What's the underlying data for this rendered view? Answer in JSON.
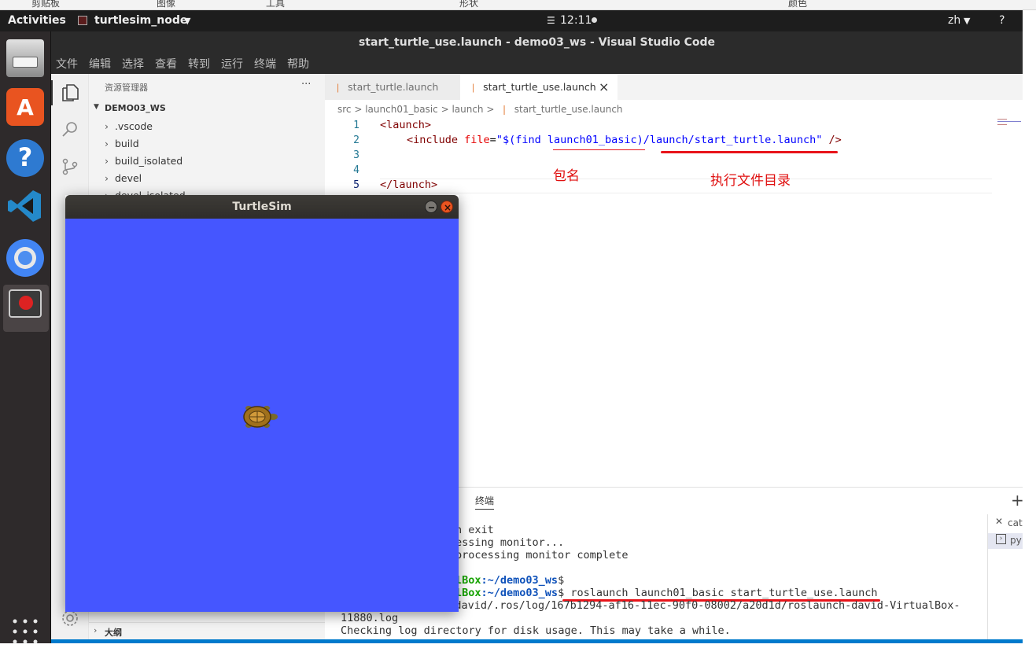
{
  "ribbon": {
    "items": [
      "剪贴板",
      "图像",
      "工具",
      "形状",
      "颜色"
    ]
  },
  "topbar": {
    "activities": "Activities",
    "app": "turtlesim_node",
    "clock": "12:11",
    "lang": "zh",
    "help": "?"
  },
  "window": {
    "title": "start_turtle_use.launch - demo03_ws - Visual Studio Code"
  },
  "menu": [
    "文件",
    "编辑",
    "选择",
    "查看",
    "转到",
    "运行",
    "终端",
    "帮助"
  ],
  "explorer": {
    "title": "资源管理器",
    "more": "···",
    "root": "DEMO03_WS",
    "items": [
      ".vscode",
      "build",
      "build_isolated",
      "devel",
      "devel_isolated"
    ],
    "outline": "大纲"
  },
  "tabs": [
    {
      "label": "start_turtle.launch",
      "active": false
    },
    {
      "label": "start_turtle_use.launch",
      "active": true,
      "close": "×"
    }
  ],
  "breadcrumb": [
    "src",
    "launch01_basic",
    "launch",
    "start_turtle_use.launch"
  ],
  "code": {
    "line_numbers": [
      "1",
      "2",
      "3",
      "4",
      "5"
    ],
    "l1_tag": "<launch>",
    "l2_open": "<include ",
    "l2_attr": "file",
    "l2_eq": "=",
    "l2_value": "\"$(find launch01_basic)/launch/start_turtle.launch\"",
    "l2_close": " />",
    "l5_tag": "</launch>"
  },
  "annotations": {
    "package_name": "包名",
    "file_dir": "执行文件目录"
  },
  "panel": {
    "tab": "终端",
    "plus": "+",
    "side_items": [
      "cat",
      "py"
    ],
    "lines": {
      "l1": "n exit",
      "l2": "essing monitor...",
      "l3": "processing monitor complete",
      "p1_host": "lBox",
      "p1_path": ":~/demo03_ws",
      "p1_dollar": "$",
      "p2_host": "lBox",
      "p2_path": ":~/demo03_ws",
      "p2_cmd": "$ roslaunch launch01_basic start_turtle_use.launch",
      "l6": "me/david/.ros/log/167b1294-af16-11ec-90f0-08002/a20d1d/roslaunch-david-VirtualBox-",
      "l7": "11880.log",
      "l8": "Checking log directory for disk usage. This may take a while."
    }
  },
  "turtlesim": {
    "title": "TurtleSim",
    "bg_color": "#4556ff"
  }
}
